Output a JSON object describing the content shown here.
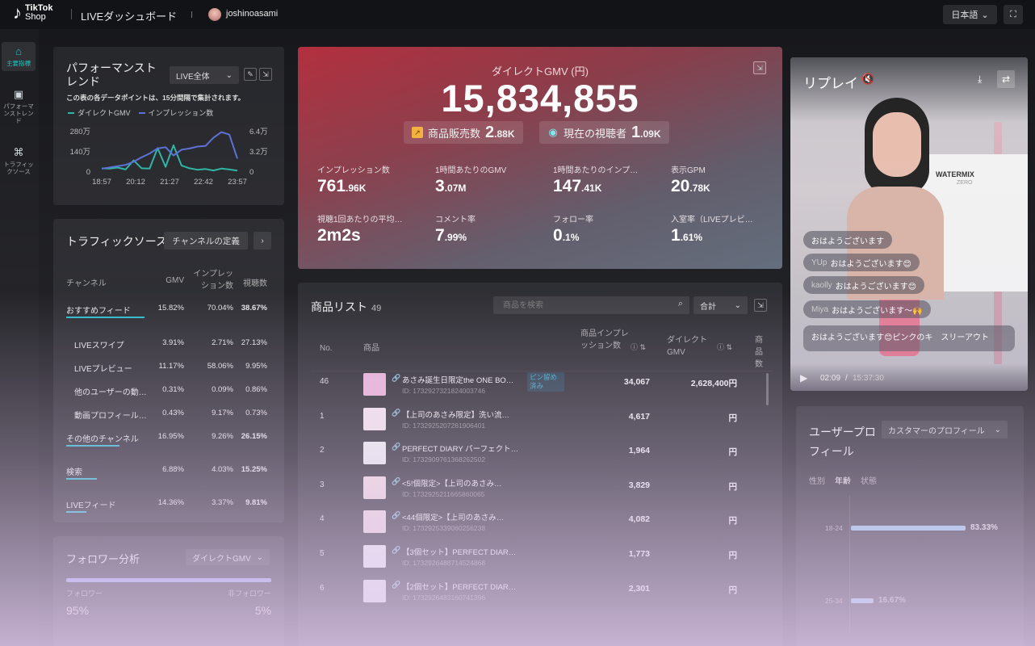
{
  "topbar": {
    "logo_primary": "TikTok",
    "logo_secondary": "Shop",
    "title": "LIVEダッシュボード",
    "username": "joshinoasami",
    "language": "日本語",
    "language_icon": "chevron-down-icon",
    "fullscreen_icon": "fullscreen-icon"
  },
  "sidebar": {
    "items": [
      {
        "label": "主要指標",
        "icon": "home-icon",
        "active": true
      },
      {
        "label": "パフォーマンストレンド",
        "icon": "trend-icon",
        "active": false
      },
      {
        "label": "トラフィックソース",
        "icon": "network-icon",
        "active": false
      }
    ]
  },
  "performance": {
    "title": "パフォーマンストレンド",
    "select": "LIVE全体",
    "note": "この表の各データポイントは、15分間隔で集計されます。",
    "legend": [
      "ダイレクトGMV",
      "インプレッション数"
    ],
    "legend_colors": [
      "#2bb5a3",
      "#5b6fd6"
    ]
  },
  "chart_data": {
    "type": "line",
    "x": [
      "18:57",
      "20:12",
      "21:27",
      "22:42",
      "23:57"
    ],
    "y_left_ticks": [
      "280万",
      "140万",
      "0"
    ],
    "y_right_ticks": [
      "6.4万",
      "3.2万",
      "0"
    ],
    "series": [
      {
        "name": "ダイレクトGMV",
        "color": "#2bb5a3",
        "values": [
          20,
          18,
          25,
          12,
          75,
          20,
          18,
          160,
          30,
          180,
          40,
          20,
          10,
          15,
          5,
          18,
          12,
          4
        ]
      },
      {
        "name": "インプレッション数",
        "color": "#5b6fd6",
        "values": [
          0.4,
          0.6,
          0.8,
          1.0,
          1.5,
          2.2,
          2.8,
          3.6,
          3.8,
          2.5,
          3.4,
          3.6,
          3.9,
          4.0,
          5.3,
          6.2,
          5.8,
          2.0
        ]
      }
    ],
    "ylim_left": [
      0,
      280
    ],
    "ylim_right": [
      0,
      6.4
    ]
  },
  "traffic": {
    "title": "トラフィックソース",
    "define_button": "チャンネルの定義",
    "headers": [
      "チャンネル",
      "GMV",
      "インプレッション数",
      "視聴数"
    ],
    "rows": [
      {
        "name": "おすすめフィード",
        "gmv": "15.82%",
        "imp": "70.04%",
        "views": "38.67%",
        "share": 0.387,
        "indent": false,
        "bold": true
      },
      {
        "name": "LIVEスワイプ",
        "gmv": "3.91%",
        "imp": "2.71%",
        "views": "27.13%",
        "share": 0,
        "indent": true,
        "bold": false
      },
      {
        "name": "LIVEプレビュー",
        "gmv": "11.17%",
        "imp": "58.06%",
        "views": "9.95%",
        "share": 0,
        "indent": true,
        "bold": false
      },
      {
        "name": "他のユーザーの動…",
        "gmv": "0.31%",
        "imp": "0.09%",
        "views": "0.86%",
        "share": 0,
        "indent": true,
        "bold": false
      },
      {
        "name": "動画プロフィール…",
        "gmv": "0.43%",
        "imp": "9.17%",
        "views": "0.73%",
        "share": 0,
        "indent": true,
        "bold": false
      },
      {
        "name": "その他のチャンネル",
        "gmv": "16.95%",
        "imp": "9.26%",
        "views": "26.15%",
        "share": 0.262,
        "indent": false,
        "bold": true
      },
      {
        "name": "検索",
        "gmv": "6.88%",
        "imp": "4.03%",
        "views": "15.25%",
        "share": 0.153,
        "indent": false,
        "bold": true
      },
      {
        "name": "LIVEフィード",
        "gmv": "14.36%",
        "imp": "3.37%",
        "views": "9.81%",
        "share": 0.098,
        "indent": false,
        "bold": true
      }
    ]
  },
  "followers": {
    "title": "フォロワー分析",
    "select": "ダイレクトGMV",
    "follower_label": "フォロワー",
    "nonfollower_label": "非フォロワー",
    "follower_value": "95%",
    "nonfollower_value": "5%"
  },
  "hero": {
    "label": "ダイレクトGMV (円)",
    "value": "15,834,855",
    "chips": [
      {
        "label": "商品販売数",
        "value": "2",
        "unit": ".88K",
        "icon": "chart-icon"
      },
      {
        "label": "現在の視聴者",
        "value": "1",
        "unit": ".09K",
        "icon": "eye-icon"
      }
    ],
    "metrics": [
      {
        "label": "インプレッション数",
        "value": "761",
        "unit": ".96K"
      },
      {
        "label": "1時間あたりのGMV",
        "value": "3",
        "unit": ".07M"
      },
      {
        "label": "1時間あたりのインプ…",
        "value": "147",
        "unit": ".41K"
      },
      {
        "label": "表示GPM",
        "value": "20",
        "unit": ".78K"
      },
      {
        "label": "視聴1回あたりの平均…",
        "value": "2m2s",
        "unit": ""
      },
      {
        "label": "コメント率",
        "value": "7",
        "unit": ".99%"
      },
      {
        "label": "フォロー率",
        "value": "0",
        "unit": ".1%"
      },
      {
        "label": "入室率（LIVEプレビ…",
        "value": "1",
        "unit": ".61%"
      }
    ]
  },
  "products": {
    "title": "商品リスト",
    "count": "49",
    "search_placeholder": "商品を検索",
    "select": "合計",
    "headers": {
      "no": "No.",
      "product": "商品",
      "imp": "商品インプレッション数",
      "gmv": "ダイレクトGMV",
      "extra": "商品数"
    },
    "pin_badge": "ピン留め済み",
    "rows": [
      {
        "no": "46",
        "name": "あさみ誕生日限定the ONE BO…",
        "id": "ID: 1732927321824003746",
        "imp": "34,067",
        "gmv": "2,628,400円",
        "pinned": true
      },
      {
        "no": "1",
        "name": "【上司のあさみ限定】洗い流…",
        "id": "ID: 1732925207261906401",
        "imp": "4,617",
        "gmv": "円",
        "pinned": false
      },
      {
        "no": "2",
        "name": "PERFECT DIARY パーフェクト…",
        "id": "ID: 1732909761368262502",
        "imp": "1,964",
        "gmv": "円",
        "pinned": false
      },
      {
        "no": "3",
        "name": "<5!個限定>【上司のあさみ…",
        "id": "ID: 1732925211665860065",
        "imp": "3,829",
        "gmv": "円",
        "pinned": false
      },
      {
        "no": "4",
        "name": "<44個限定>【上司のあさみ…",
        "id": "ID: 1732925339060256238",
        "imp": "4,082",
        "gmv": "円",
        "pinned": false
      },
      {
        "no": "5",
        "name": "【3個セット】PERFECT DIAR…",
        "id": "ID: 1732926488714524868",
        "imp": "1,773",
        "gmv": "円",
        "pinned": false
      },
      {
        "no": "6",
        "name": "【2個セット】PERFECT DIAR…",
        "id": "ID: 1732926483160741396",
        "imp": "2,301",
        "gmv": "円",
        "pinned": false
      }
    ]
  },
  "replay": {
    "title": "リプレイ",
    "time_current": "02:09",
    "time_total": "15:37:30",
    "product_text": "WATERMIX",
    "product_sub": "ZERO",
    "comments": [
      {
        "user": "",
        "text": "おはようございます"
      },
      {
        "user": "YUp",
        "text": "おはようございます😊"
      },
      {
        "user": "kaolly",
        "text": "おはようございます😊"
      },
      {
        "user": "Miya",
        "text": "おはようございます〜🙌"
      },
      {
        "user": "",
        "text": "おはようございます😊ピンクのキ　スリーアウト"
      }
    ]
  },
  "audience": {
    "title": "ユーザープロフィール",
    "select": "カスタマーのプロフィール",
    "tabs": [
      "性別",
      "年齢",
      "状態"
    ],
    "rows": [
      {
        "label": "18-24",
        "value": "83.33%",
        "share": 0.8333
      },
      {
        "label": "25-34",
        "value": "16.67%",
        "share": 0.1667
      }
    ]
  }
}
